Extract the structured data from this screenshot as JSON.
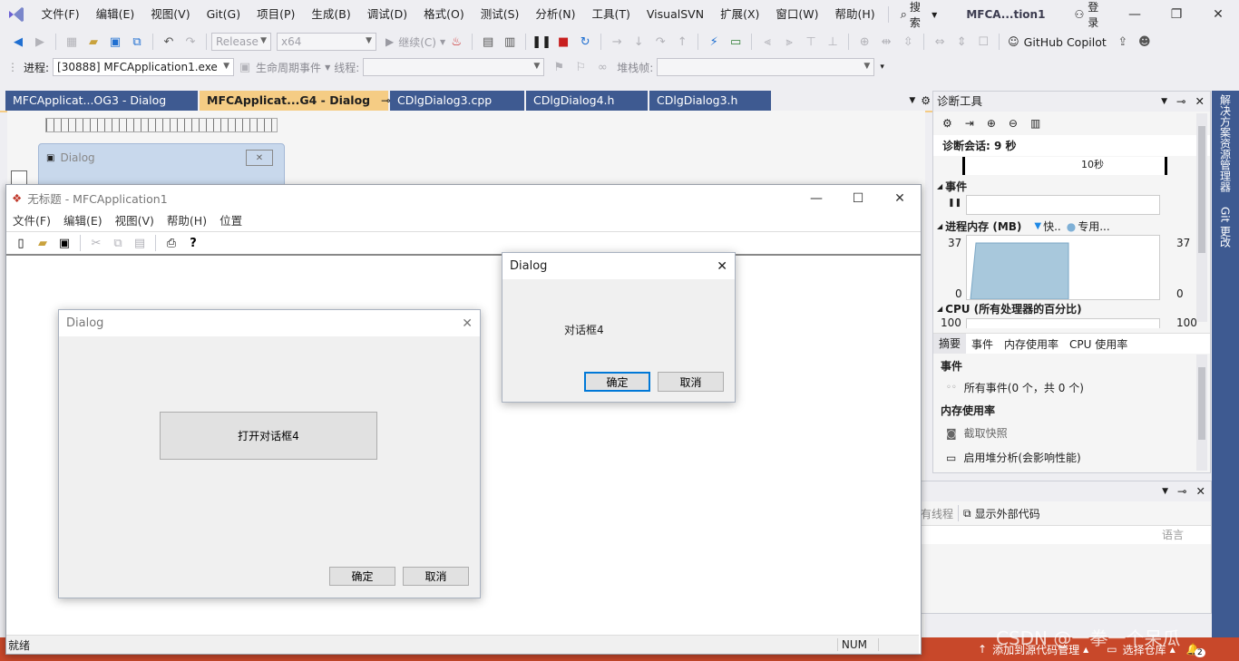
{
  "vs": {
    "menu": [
      "文件(F)",
      "编辑(E)",
      "视图(V)",
      "Git(G)",
      "项目(P)",
      "生成(B)",
      "调试(D)",
      "格式(O)",
      "测试(S)",
      "分析(N)",
      "工具(T)",
      "VisualSVN",
      "扩展(X)",
      "窗口(W)",
      "帮助(H)"
    ],
    "search_label": "搜索",
    "solution_title": "MFCA...tion1",
    "login_label": "登录",
    "config": "Release",
    "platform": "x64",
    "continue_label": "继续(C)",
    "copilot_label": "GitHub Copilot",
    "process_label": "进程:",
    "process_value": "[30888] MFCApplication1.exe",
    "lifecycle_label": "生命周期事件",
    "thread_label": "线程:",
    "stack_label": "堆栈帧:",
    "tabs": [
      "MFCApplicat...OG3 - Dialog",
      "MFCApplicat...G4 - Dialog",
      "CDlgDialog3.cpp",
      "CDlgDialog4.h",
      "CDlgDialog3.h"
    ],
    "designer_dialog_title": "Dialog"
  },
  "diag": {
    "title": "诊断工具",
    "session": "诊断会话: 9 秒",
    "timeline_label": "10秒",
    "events_header": "事件",
    "memory_header": "进程内存 (MB)",
    "memory_legend_fast": "快..",
    "memory_legend_private": "专用...",
    "mem_max_left": "37",
    "mem_min_left": "0",
    "mem_max_right": "37",
    "mem_min_right": "0",
    "cpu_header": "CPU (所有处理器的百分比)",
    "cpu_left": "100",
    "cpu_right": "100",
    "tabs": [
      "摘要",
      "事件",
      "内存使用率",
      "CPU 使用率"
    ],
    "events_section": "事件",
    "all_events": "所有事件(0 个，共 0 个)",
    "memory_section": "内存使用率",
    "snapshot": "截取快照",
    "heap_analysis": "启用堆分析(会影响性能)"
  },
  "side": {
    "solution_explorer": "解决方案资源管理器",
    "git_changes": "Git 更改"
  },
  "bottom": {
    "threads_label": "有线程",
    "external_code": "显示外部代码",
    "lang_header": "语言"
  },
  "status": {
    "source_control": "添加到源代码管理",
    "select_repo": "选择仓库",
    "notif_count": "2",
    "watermark": "CSDN @一拳一个呆瓜"
  },
  "app": {
    "title": "无标题 - MFCApplication1",
    "menu": [
      "文件(F)",
      "编辑(E)",
      "视图(V)",
      "帮助(H)",
      "位置"
    ],
    "status_ready": "就绪",
    "status_num": "NUM"
  },
  "dialog3": {
    "title": "Dialog",
    "open_button": "打开对话框4",
    "ok": "确定",
    "cancel": "取消"
  },
  "dialog4": {
    "title": "Dialog",
    "message": "对话框4",
    "ok": "确定",
    "cancel": "取消"
  }
}
